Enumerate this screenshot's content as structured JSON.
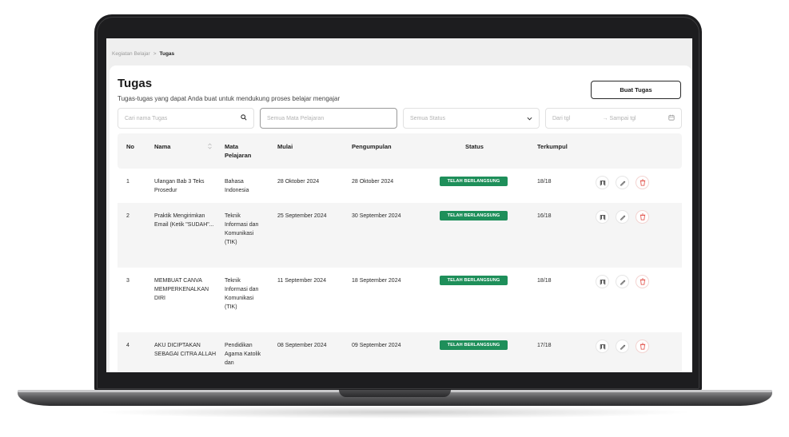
{
  "breadcrumb": {
    "parent": "Kegiatan Belajar",
    "separator": ">",
    "current": "Tugas"
  },
  "page": {
    "title": "Tugas",
    "subtitle": "Tugas-tugas yang dapat Anda buat untuk mendukung proses belajar mengajar",
    "create_button": "Buat Tugas"
  },
  "filters": {
    "search_placeholder": "Cari nama Tugas",
    "subject_placeholder": "Semua Mata Pelajaran",
    "status_placeholder": "Semua Status",
    "date_from": "Dari tgl",
    "date_arrow": "→",
    "date_to": "Sampai tgl"
  },
  "table": {
    "headers": {
      "no": "No",
      "name": "Nama",
      "subject": "Mata Pelajaran",
      "start": "Mulai",
      "due": "Pengumpulan",
      "status": "Status",
      "count": "Terkumpul"
    },
    "rows": [
      {
        "no": "1",
        "name": "Ulangan Bab 3 Teks Prosedur",
        "subject": "Bahasa Indonesia",
        "start": "28 Oktober 2024",
        "due": "28 Oktober 2024",
        "status": "TELAH BERLANGSUNG",
        "count": "18/18"
      },
      {
        "no": "2",
        "name": "Praktik Mengirimkan Email (Ketik \"SUDAH\"...",
        "subject": "Teknik Informasi dan Komunikasi (TIK)",
        "start": "25 September 2024",
        "due": "30 September 2024",
        "status": "TELAH BERLANGSUNG",
        "count": "16/18"
      },
      {
        "no": "3",
        "name": "MEMBUAT CANVA MEMPERKENALKAN DIRI",
        "subject": "Teknik Informasi dan Komunikasi (TIK)",
        "start": "11 September 2024",
        "due": "18 September 2024",
        "status": "TELAH BERLANGSUNG",
        "count": "18/18"
      },
      {
        "no": "4",
        "name": "AKU DICIPTAKAN SEBAGAI CITRA ALLAH",
        "subject": "Pendidikan Agama Katolik dan",
        "start": "08 September 2024",
        "due": "09 September 2024",
        "status": "TELAH BERLANGSUNG",
        "count": "17/18"
      }
    ]
  },
  "colors": {
    "status_badge": "#1e8f5a",
    "delete_icon": "#e0463e",
    "laptop_body": "#1d1d1f"
  },
  "icons": {
    "search": "search-icon",
    "dropdown": "chevron-down-icon",
    "calendar": "calendar-icon",
    "sort": "sort-icon",
    "view": "view-icon",
    "edit": "pencil-icon",
    "delete": "trash-icon"
  }
}
